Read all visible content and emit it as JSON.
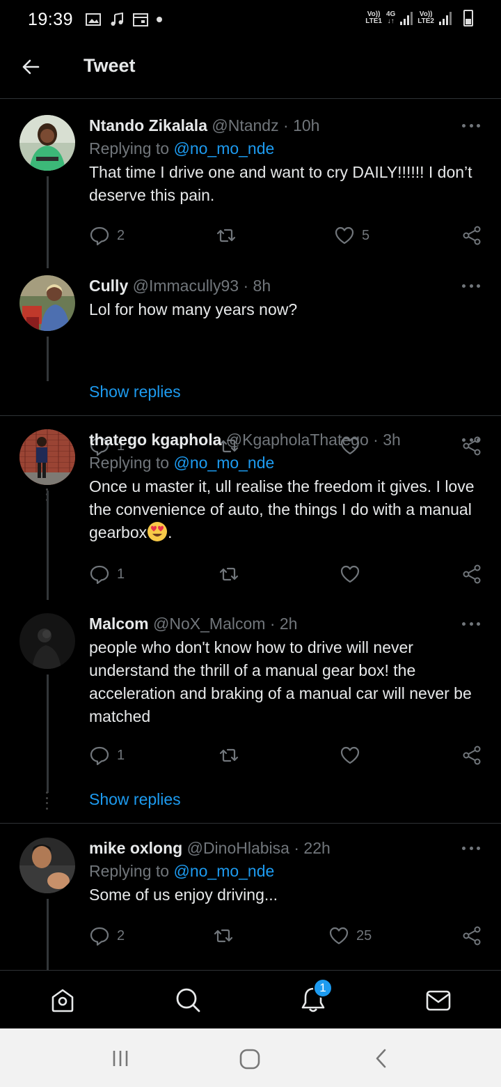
{
  "status_bar": {
    "time": "19:39",
    "sim1_top": "Vo))",
    "sim1_bottom": "LTE1",
    "network": "4G",
    "sim2_top": "Vo))",
    "sim2_bottom": "LTE2"
  },
  "header": {
    "title": "Tweet"
  },
  "tweets": [
    {
      "name": "Ntando Zikalala",
      "handle": "@Ntandz",
      "sep": "·",
      "age": "10h",
      "replying_prefix": "Replying to",
      "replying_to": "@no_mo_nde",
      "text": "That time I drive one and want to cry DAILY!!!!!! I don’t deserve this pain.",
      "replies": "2",
      "likes": "5"
    },
    {
      "name": "Cully",
      "handle": "@Immacully93",
      "sep": "·",
      "age": "8h",
      "text": "Lol for how many years now?",
      "replies": "1",
      "show_replies": "Show replies"
    },
    {
      "name": "thatego kgaphola",
      "handle": "@KgapholaThatego",
      "sep": "·",
      "age": "3h",
      "replying_prefix": "Replying to",
      "replying_to": "@no_mo_nde",
      "text": "Once u master it, ull realise the freedom it gives. I love the convenience of auto, the things I do with a manual gearbox",
      "text_end": ".",
      "replies": "1"
    },
    {
      "name": "Malcom",
      "handle": "@NoX_Malcom",
      "sep": "·",
      "age": "2h",
      "text": "people who don't know how to drive will never understand the thrill of a manual gear box! the acceleration and braking of a manual car will never be matched",
      "replies": "1",
      "show_replies": "Show replies"
    },
    {
      "name": "mike oxlong",
      "handle": "@DinoHlabisa",
      "sep": "·",
      "age": "22h",
      "replying_prefix": "Replying to",
      "replying_to": "@no_mo_nde",
      "text": "Some of us enjoy driving...",
      "replies": "2",
      "likes": "25"
    }
  ],
  "bottom_nav": {
    "notification_count": "1"
  },
  "colors": {
    "background": "#000000",
    "accent": "#1d9bf0",
    "muted": "#71767b",
    "text": "#e7e9ea"
  }
}
